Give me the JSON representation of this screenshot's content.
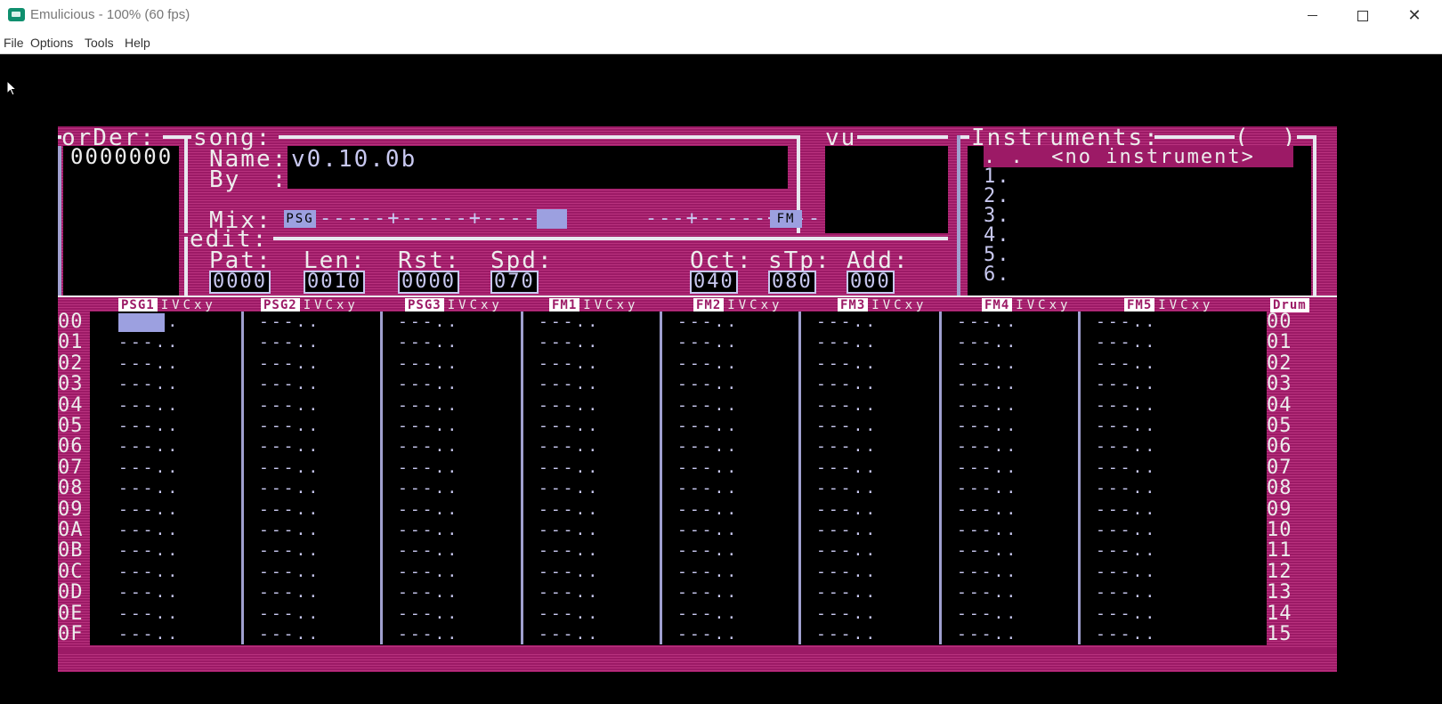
{
  "window": {
    "title": "Emulicious - 100% (60 fps)",
    "minimize_glyph": "—",
    "maximize_glyph": "☐",
    "close_glyph": "✕"
  },
  "menu": [
    "File",
    "Options",
    "Tools",
    "Help"
  ],
  "order": {
    "label": "orDer:",
    "value": "0000000"
  },
  "song": {
    "label": "song:",
    "name_label": "Name:",
    "name_value": "v0.10.0b",
    "by_label": "By  :",
    "by_value": "",
    "mix_label": "Mix:",
    "mix_left": "PSG",
    "mix_right": "FM",
    "mix_track": "-----+-----+----        ---+-----+-----"
  },
  "vu_label": "vu",
  "instruments": {
    "label": "Instruments:",
    "bracket": "(  )",
    "items": [
      ". .  <no instrument>",
      "1.",
      "2.",
      "3.",
      "4.",
      "5.",
      "6."
    ]
  },
  "edit": {
    "label": "edit:",
    "fields": [
      {
        "label": "Pat:",
        "value": "0000"
      },
      {
        "label": "Len:",
        "value": "0010"
      },
      {
        "label": "Rst:",
        "value": "0000"
      },
      {
        "label": "Spd:",
        "value": "070"
      },
      {
        "label": "Oct:",
        "value": "040"
      },
      {
        "label": "sTp:",
        "value": "080"
      },
      {
        "label": "Add:",
        "value": "000"
      }
    ]
  },
  "channels": [
    {
      "name": "PSG1",
      "flags": "IVCxy"
    },
    {
      "name": "PSG2",
      "flags": "IVCxy"
    },
    {
      "name": "PSG3",
      "flags": "IVCxy"
    },
    {
      "name": "FM1",
      "flags": "IVCxy"
    },
    {
      "name": "FM2",
      "flags": "IVCxy"
    },
    {
      "name": "FM3",
      "flags": "IVCxy"
    },
    {
      "name": "FM4",
      "flags": "IVCxy"
    },
    {
      "name": "FM5",
      "flags": "IVCxy"
    },
    {
      "name": "Drum",
      "flags": ""
    }
  ],
  "rows_hex": [
    "00",
    "01",
    "02",
    "03",
    "04",
    "05",
    "06",
    "07",
    "08",
    "09",
    "0A",
    "0B",
    "0C",
    "0D",
    "0E",
    "0F"
  ],
  "rows_dec": [
    "00",
    "01",
    "02",
    "03",
    "04",
    "05",
    "06",
    "07",
    "08",
    "09",
    "10",
    "11",
    "12",
    "13",
    "14",
    "15"
  ],
  "empty_cell": "---.."
}
